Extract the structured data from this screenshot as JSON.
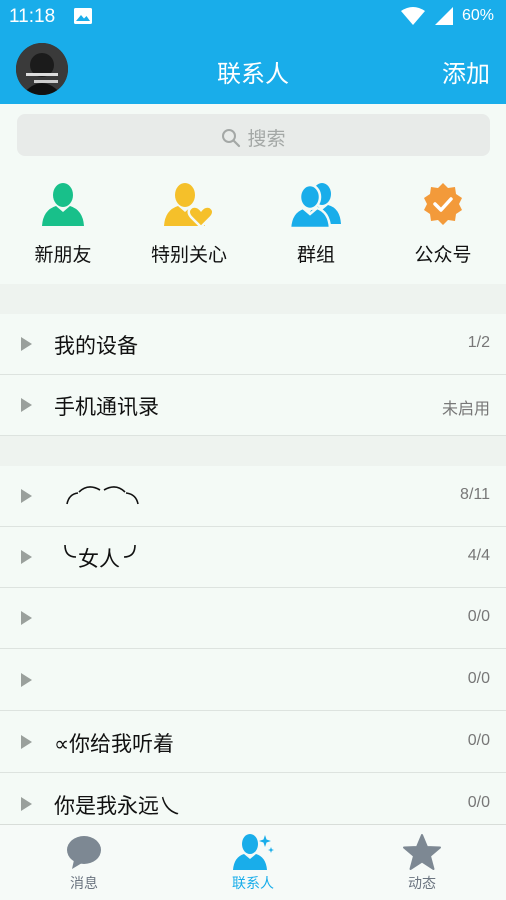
{
  "status_bar": {
    "time": "11:18",
    "battery": "60%"
  },
  "header": {
    "title": "联系人",
    "add_label": "添加"
  },
  "search": {
    "placeholder": "搜索"
  },
  "quick_entries": [
    {
      "label": "新朋友",
      "icon": "new-friend-icon",
      "color": "#18c08a"
    },
    {
      "label": "特别关心",
      "icon": "special-care-icon",
      "color": "#f5c02a"
    },
    {
      "label": "群组",
      "icon": "group-icon",
      "color": "#19adea"
    },
    {
      "label": "公众号",
      "icon": "public-account-icon",
      "color": "#f39a3a"
    }
  ],
  "device_section": [
    {
      "name": "我的设备",
      "count": "1/2"
    },
    {
      "name": "手机通讯录",
      "count": "未启用"
    }
  ],
  "groups": [
    {
      "name": "",
      "count": "8/11"
    },
    {
      "name": "女人",
      "count": "4/4"
    },
    {
      "name": "",
      "count": "0/0"
    },
    {
      "name": "",
      "count": "0/0"
    },
    {
      "name": "∝你给我听着",
      "count": "0/0"
    },
    {
      "name": "你是我永远乀",
      "count": "0/0"
    }
  ],
  "tabs": [
    {
      "label": "消息",
      "icon": "message-icon",
      "active": false
    },
    {
      "label": "联系人",
      "icon": "contacts-icon",
      "active": true
    },
    {
      "label": "动态",
      "icon": "star-icon",
      "active": false
    }
  ],
  "colors": {
    "primary": "#19adea",
    "background": "#f4faf6"
  }
}
